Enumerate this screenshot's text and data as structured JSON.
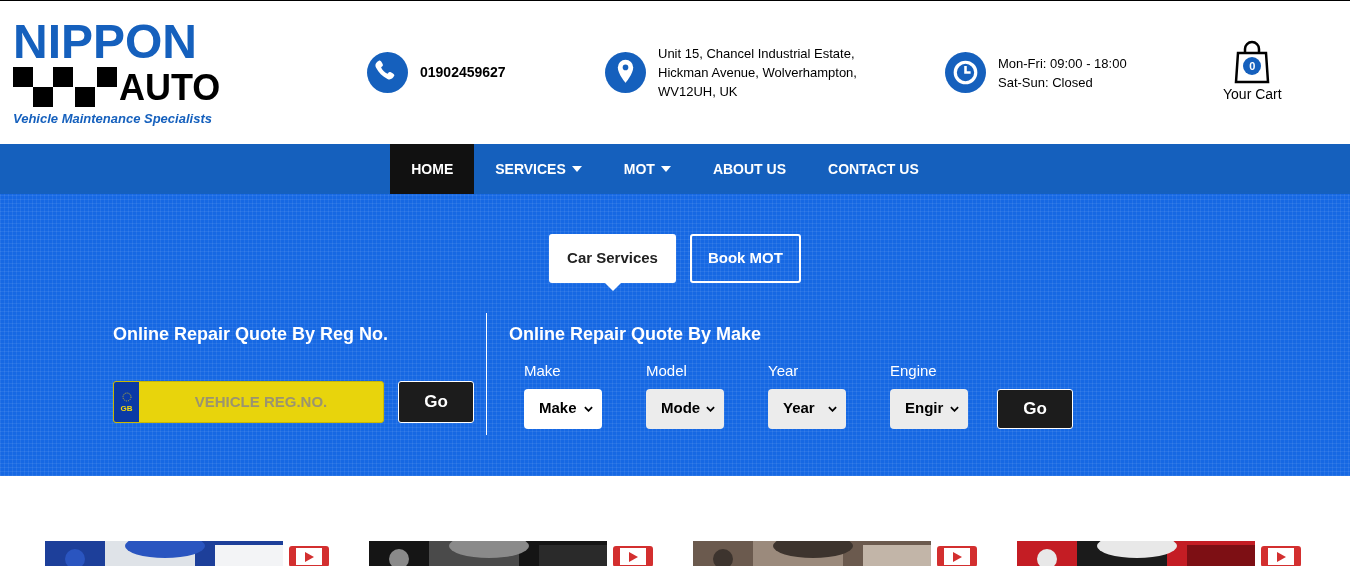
{
  "logo": {
    "name": "NIPPON",
    "word": "AUTO",
    "tagline": "Vehicle Maintenance Specialists"
  },
  "contacts": [
    {
      "kind": "phone",
      "lines": [
        "01902459627"
      ]
    },
    {
      "kind": "location",
      "lines": [
        "Unit 15, Chancel Industrial Estate,",
        "Hickman Avenue, Wolverhampton,",
        "WV12UH, UK"
      ]
    },
    {
      "kind": "clock",
      "lines": [
        "Mon-Fri: 09:00 - 18:00",
        "Sat-Sun: Closed"
      ]
    }
  ],
  "cart": {
    "count": "0",
    "label": "Your Cart"
  },
  "nav": [
    {
      "label": "HOME",
      "selected": true,
      "dropdown": false
    },
    {
      "label": "SERVICES",
      "selected": false,
      "dropdown": true
    },
    {
      "label": "MOT",
      "selected": false,
      "dropdown": true
    },
    {
      "label": "ABOUT US",
      "selected": false,
      "dropdown": false
    },
    {
      "label": "CONTACT US",
      "selected": false,
      "dropdown": false
    }
  ],
  "tabs": [
    {
      "label": "Car Services",
      "selected": true
    },
    {
      "label": "Book MOT",
      "selected": false
    }
  ],
  "reg_quote": {
    "title": "Online Repair Quote By Reg No.",
    "placeholder": "VEHICLE REG.NO.",
    "plate_country": "GB",
    "button": "Go"
  },
  "make_quote": {
    "title": "Online Repair Quote By Make",
    "fields": [
      {
        "label": "Make",
        "value": "Make",
        "disabled": false
      },
      {
        "label": "Model",
        "value": "Mode",
        "disabled": true
      },
      {
        "label": "Year",
        "value": "Year",
        "disabled": true
      },
      {
        "label": "Engine",
        "value": "Engir",
        "disabled": true
      }
    ],
    "button": "Go"
  }
}
